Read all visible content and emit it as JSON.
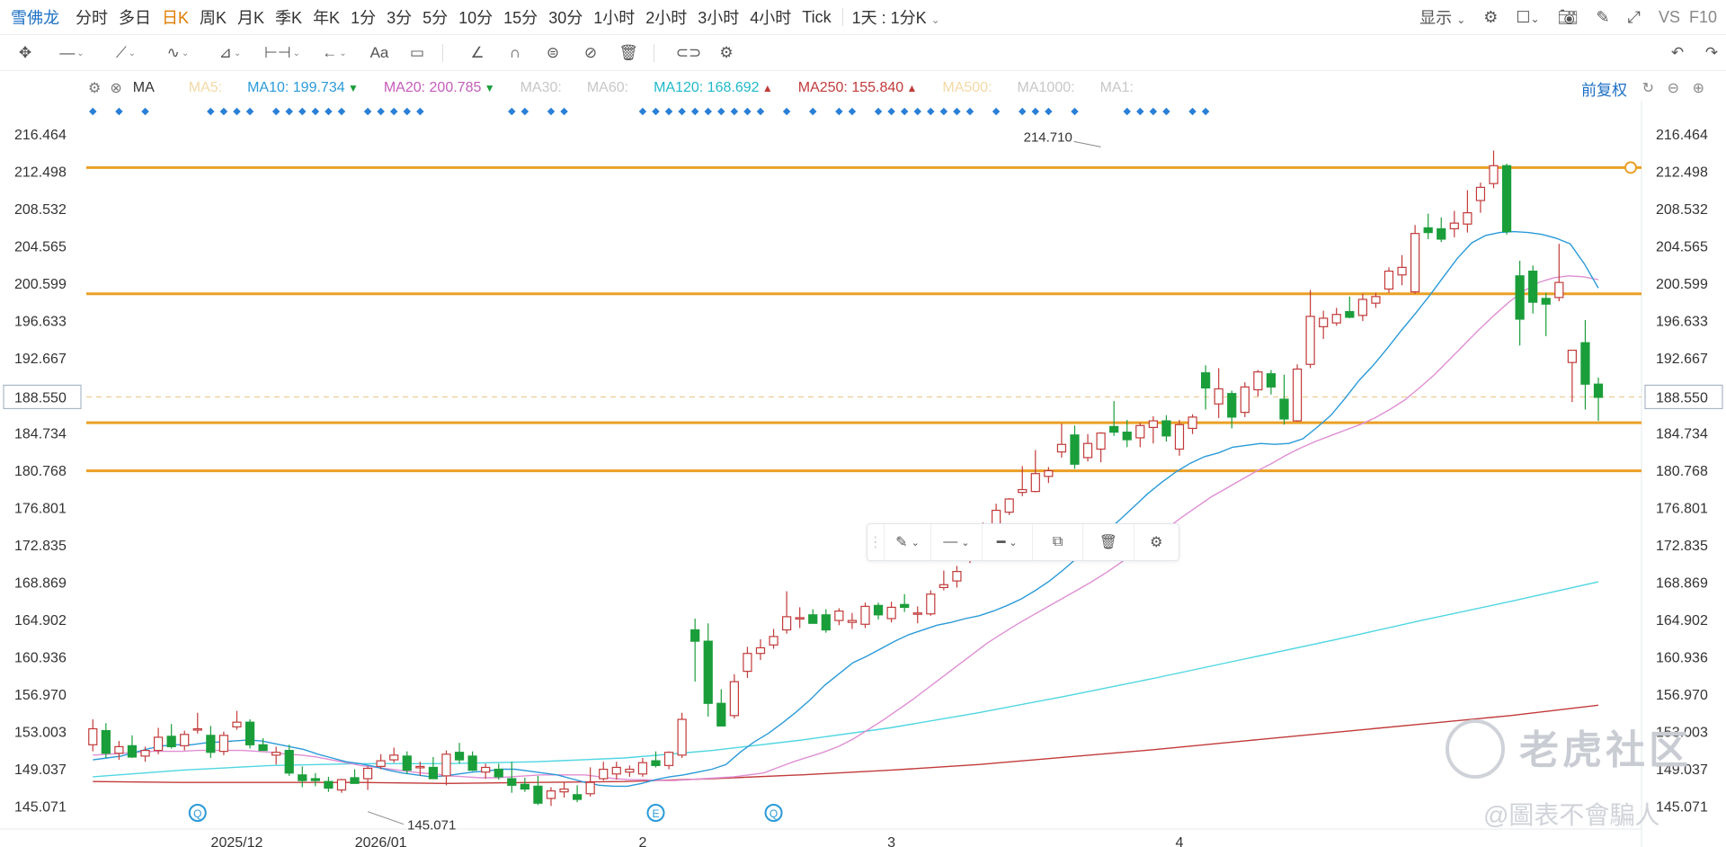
{
  "toolbar": {
    "symbol": "雪佛龙",
    "timeframes": [
      "分时",
      "多日",
      "日K",
      "周K",
      "月K",
      "季K",
      "年K",
      "1分",
      "3分",
      "5分",
      "10分",
      "15分",
      "30分",
      "1小时",
      "2小时",
      "3小时",
      "4小时",
      "Tick"
    ],
    "active_timeframe": "日K",
    "mode": "1天 : 1分K",
    "display": "显示",
    "compare": "VS",
    "f10": "F10"
  },
  "indicator": {
    "name": "MA",
    "adjust": "前复权",
    "items": [
      {
        "label": "MA5:",
        "value": "",
        "arrow": "",
        "color": "#f3d9a6"
      },
      {
        "label": "MA10:",
        "value": "199.734",
        "arrow": "▼",
        "color": "#2a9ad8"
      },
      {
        "label": "MA20:",
        "value": "200.785",
        "arrow": "▼",
        "color": "#c45cba"
      },
      {
        "label": "MA30:",
        "value": "",
        "arrow": "",
        "color": "#c7c7c7"
      },
      {
        "label": "MA60:",
        "value": "",
        "arrow": "",
        "color": "#c7c7c7"
      },
      {
        "label": "MA120:",
        "value": "168.692",
        "arrow": "▲",
        "color": "#1fb8c9"
      },
      {
        "label": "MA250:",
        "value": "155.840",
        "arrow": "▲",
        "color": "#c23a3a"
      },
      {
        "label": "MA500:",
        "value": "",
        "arrow": "",
        "color": "#f3d9a6"
      },
      {
        "label": "MA1000:",
        "value": "",
        "arrow": "",
        "color": "#c7c7c7"
      },
      {
        "label": "MA1:",
        "value": "",
        "arrow": "",
        "color": "#c7c7c7"
      }
    ]
  },
  "colors": {
    "up": "#c23a3a",
    "down": "#1a9e3a",
    "hline": "#eaa025",
    "ma10": "#2a9ad8",
    "ma20": "#df8fd3",
    "ma120": "#4fd6e2",
    "ma250": "#c23a3a"
  },
  "chart_data": {
    "type": "candlestick",
    "y_ticks": [
      "216.464",
      "212.498",
      "208.532",
      "204.565",
      "200.599",
      "196.633",
      "192.667",
      "188.550",
      "184.734",
      "180.768",
      "176.801",
      "172.835",
      "168.869",
      "164.902",
      "160.936",
      "156.970",
      "153.003",
      "149.037",
      "145.071"
    ],
    "ylim": [
      143.8,
      217.9
    ],
    "x_labels": [
      {
        "label": "2025/12",
        "index": 11
      },
      {
        "label": "2026/01",
        "index": 22
      },
      {
        "label": "2",
        "index": 42
      },
      {
        "label": "3",
        "index": 61
      },
      {
        "label": "4",
        "index": 83
      }
    ],
    "last_price": 188.55,
    "high_marker": {
      "value": 214.71,
      "label": "214.710",
      "index": 77
    },
    "low_marker": {
      "value": 145.071,
      "label": "145.071",
      "index": 21
    },
    "horizontal_lines": [
      212.9,
      199.5,
      185.8,
      180.7
    ],
    "markers": [
      {
        "index": 8,
        "symbol": "Q"
      },
      {
        "index": 43,
        "symbol": "E"
      },
      {
        "index": 52,
        "symbol": "Q"
      }
    ],
    "signal_dots": [
      0,
      2,
      4,
      9,
      10,
      11,
      12,
      14,
      15,
      16,
      17,
      18,
      19,
      21,
      22,
      23,
      24,
      25,
      32,
      33,
      35,
      36,
      42,
      43,
      44,
      45,
      46,
      47,
      48,
      49,
      50,
      51,
      53,
      55,
      57,
      58,
      60,
      61,
      62,
      63,
      64,
      65,
      66,
      67,
      69,
      71,
      72,
      73,
      75,
      79,
      80,
      81,
      82,
      84,
      85
    ],
    "candles": [
      {
        "o": 151.6,
        "h": 154.3,
        "l": 150.9,
        "c": 153.3
      },
      {
        "o": 153.1,
        "h": 153.9,
        "l": 150.2,
        "c": 150.7
      },
      {
        "o": 150.7,
        "h": 152.0,
        "l": 150.0,
        "c": 151.4
      },
      {
        "o": 151.5,
        "h": 152.6,
        "l": 150.2,
        "c": 150.3
      },
      {
        "o": 150.4,
        "h": 151.4,
        "l": 149.8,
        "c": 151.0
      },
      {
        "o": 151.0,
        "h": 153.4,
        "l": 150.6,
        "c": 152.4
      },
      {
        "o": 152.5,
        "h": 153.8,
        "l": 151.2,
        "c": 151.4
      },
      {
        "o": 151.5,
        "h": 153.1,
        "l": 151.0,
        "c": 152.7
      },
      {
        "o": 153.2,
        "h": 155.0,
        "l": 152.8,
        "c": 153.3
      },
      {
        "o": 152.6,
        "h": 153.6,
        "l": 150.2,
        "c": 150.8
      },
      {
        "o": 150.9,
        "h": 153.0,
        "l": 150.5,
        "c": 152.6
      },
      {
        "o": 153.5,
        "h": 155.2,
        "l": 153.2,
        "c": 154.0
      },
      {
        "o": 154.0,
        "h": 154.3,
        "l": 151.2,
        "c": 151.6
      },
      {
        "o": 151.6,
        "h": 152.3,
        "l": 151.0,
        "c": 151.0
      },
      {
        "o": 150.5,
        "h": 151.4,
        "l": 149.5,
        "c": 150.8
      },
      {
        "o": 151.0,
        "h": 151.6,
        "l": 148.3,
        "c": 148.6
      },
      {
        "o": 148.4,
        "h": 149.3,
        "l": 147.1,
        "c": 147.8
      },
      {
        "o": 148.0,
        "h": 148.6,
        "l": 147.2,
        "c": 147.8
      },
      {
        "o": 147.7,
        "h": 148.2,
        "l": 146.6,
        "c": 147.0
      },
      {
        "o": 146.8,
        "h": 148.0,
        "l": 146.5,
        "c": 147.9
      },
      {
        "o": 148.1,
        "h": 149.0,
        "l": 147.5,
        "c": 147.5
      },
      {
        "o": 148.0,
        "h": 149.3,
        "l": 146.8,
        "c": 149.1
      },
      {
        "o": 149.3,
        "h": 150.6,
        "l": 149.0,
        "c": 149.9
      },
      {
        "o": 150.0,
        "h": 151.3,
        "l": 149.7,
        "c": 150.5
      },
      {
        "o": 150.4,
        "h": 150.9,
        "l": 148.5,
        "c": 148.9
      },
      {
        "o": 149.2,
        "h": 149.8,
        "l": 148.3,
        "c": 149.3
      },
      {
        "o": 149.2,
        "h": 150.3,
        "l": 148.2,
        "c": 148.0
      },
      {
        "o": 148.3,
        "h": 151.0,
        "l": 147.3,
        "c": 150.6
      },
      {
        "o": 150.8,
        "h": 151.8,
        "l": 149.6,
        "c": 150.0
      },
      {
        "o": 150.4,
        "h": 150.9,
        "l": 148.8,
        "c": 148.9
      },
      {
        "o": 148.7,
        "h": 149.6,
        "l": 148.0,
        "c": 149.2
      },
      {
        "o": 149.0,
        "h": 149.6,
        "l": 147.9,
        "c": 148.2
      },
      {
        "o": 148.0,
        "h": 149.8,
        "l": 146.5,
        "c": 147.3
      },
      {
        "o": 147.4,
        "h": 148.1,
        "l": 146.6,
        "c": 146.9
      },
      {
        "o": 147.2,
        "h": 148.3,
        "l": 145.2,
        "c": 145.4
      },
      {
        "o": 145.9,
        "h": 147.1,
        "l": 145.1,
        "c": 146.7
      },
      {
        "o": 146.6,
        "h": 147.6,
        "l": 146.0,
        "c": 146.9
      },
      {
        "o": 146.3,
        "h": 147.3,
        "l": 145.5,
        "c": 145.8
      },
      {
        "o": 146.4,
        "h": 149.2,
        "l": 146.1,
        "c": 147.6
      },
      {
        "o": 148.0,
        "h": 149.8,
        "l": 147.8,
        "c": 149.0
      },
      {
        "o": 148.5,
        "h": 149.8,
        "l": 147.9,
        "c": 149.2
      },
      {
        "o": 148.7,
        "h": 149.4,
        "l": 148.2,
        "c": 149.0
      },
      {
        "o": 148.5,
        "h": 150.2,
        "l": 148.2,
        "c": 149.7
      },
      {
        "o": 149.9,
        "h": 150.9,
        "l": 149.2,
        "c": 149.4
      },
      {
        "o": 149.4,
        "h": 150.9,
        "l": 149.0,
        "c": 150.8
      },
      {
        "o": 150.5,
        "h": 155.0,
        "l": 150.2,
        "c": 154.3
      },
      {
        "o": 163.8,
        "h": 165.0,
        "l": 158.3,
        "c": 162.6
      },
      {
        "o": 162.6,
        "h": 164.5,
        "l": 154.6,
        "c": 156.0
      },
      {
        "o": 156.0,
        "h": 157.5,
        "l": 153.6,
        "c": 153.6
      },
      {
        "o": 154.7,
        "h": 159.1,
        "l": 154.4,
        "c": 158.3
      },
      {
        "o": 159.4,
        "h": 162.0,
        "l": 158.7,
        "c": 161.3
      },
      {
        "o": 161.3,
        "h": 162.8,
        "l": 160.6,
        "c": 161.9
      },
      {
        "o": 162.2,
        "h": 163.9,
        "l": 161.8,
        "c": 163.1
      },
      {
        "o": 163.8,
        "h": 167.9,
        "l": 163.4,
        "c": 165.2
      },
      {
        "o": 165.1,
        "h": 166.2,
        "l": 164.0,
        "c": 165.1
      },
      {
        "o": 165.4,
        "h": 166.0,
        "l": 164.6,
        "c": 164.5
      },
      {
        "o": 165.4,
        "h": 166.0,
        "l": 163.5,
        "c": 163.8
      },
      {
        "o": 164.8,
        "h": 166.1,
        "l": 164.3,
        "c": 165.8
      },
      {
        "o": 164.6,
        "h": 165.6,
        "l": 163.9,
        "c": 164.8
      },
      {
        "o": 164.4,
        "h": 166.7,
        "l": 164.0,
        "c": 166.3
      },
      {
        "o": 166.4,
        "h": 166.7,
        "l": 164.9,
        "c": 165.4
      },
      {
        "o": 165.0,
        "h": 166.8,
        "l": 164.6,
        "c": 166.2
      },
      {
        "o": 166.5,
        "h": 167.6,
        "l": 165.7,
        "c": 166.2
      },
      {
        "o": 165.6,
        "h": 166.3,
        "l": 164.5,
        "c": 165.6
      },
      {
        "o": 165.5,
        "h": 168.0,
        "l": 165.3,
        "c": 167.6
      },
      {
        "o": 168.3,
        "h": 170.1,
        "l": 168.0,
        "c": 168.6
      },
      {
        "o": 169.0,
        "h": 170.6,
        "l": 168.3,
        "c": 170.0
      },
      {
        "o": 171.5,
        "h": 174.4,
        "l": 170.9,
        "c": 174.0
      },
      {
        "o": 173.4,
        "h": 175.2,
        "l": 172.5,
        "c": 174.8
      },
      {
        "o": 174.8,
        "h": 177.2,
        "l": 174.4,
        "c": 176.5
      },
      {
        "o": 176.3,
        "h": 177.8,
        "l": 176.0,
        "c": 177.7
      },
      {
        "o": 178.4,
        "h": 181.2,
        "l": 178.0,
        "c": 178.7
      },
      {
        "o": 178.5,
        "h": 182.9,
        "l": 178.4,
        "c": 180.4
      },
      {
        "o": 180.1,
        "h": 181.1,
        "l": 179.4,
        "c": 180.7
      }
    ],
    "series": [
      {
        "name": "MA10",
        "values": [
          150.0,
          150.2,
          150.4,
          150.8,
          151.2,
          151.5,
          151.6,
          151.6,
          151.8,
          151.9,
          152.0,
          152.1,
          152.0,
          151.7,
          151.4,
          151.1,
          150.6,
          150.2,
          149.8,
          149.6,
          149.3,
          148.9,
          148.6,
          148.4,
          148.2,
          148.3,
          148.5,
          148.7,
          148.8,
          149.0,
          149.0,
          148.8,
          148.6,
          148.4,
          148.0,
          147.6,
          147.3,
          147.2,
          147.2,
          147.5,
          147.9,
          148.2,
          148.4,
          148.7,
          149.0,
          149.5,
          150.8,
          151.9,
          152.8,
          153.9,
          155.1,
          156.4,
          157.9,
          159.1,
          160.3,
          161.0,
          161.8,
          162.6,
          163.3,
          163.8,
          164.3,
          164.6,
          165.0,
          165.3,
          165.8,
          166.4,
          167.1,
          168.0,
          169.0,
          170.2,
          171.5,
          172.9,
          174.2,
          175.5,
          176.9,
          178.3,
          179.5,
          180.6,
          181.5,
          182.2,
          182.6,
          183.2,
          183.4,
          183.6,
          183.5,
          183.6,
          184.1,
          185.3,
          186.6,
          188.4,
          190.3,
          191.9,
          193.7,
          195.6,
          197.4,
          199.3,
          201.3,
          203.3,
          204.9,
          205.7,
          206.0,
          206.1,
          206.0,
          205.8,
          205.4,
          204.8,
          202.7,
          200.1
        ]
      },
      {
        "name": "MA20",
        "values": [
          150.5,
          150.6,
          150.7,
          150.8,
          150.9,
          150.9,
          150.9,
          151.0,
          151.0,
          151.0,
          151.0,
          150.9,
          150.8,
          150.6,
          150.5,
          150.3,
          150.0,
          149.7,
          149.4,
          149.2,
          149.0,
          148.8,
          148.6,
          148.5,
          148.3,
          148.2,
          148.1,
          148.1,
          148.2,
          148.3,
          148.4,
          148.4,
          148.4,
          148.4,
          148.2,
          148.0,
          147.9,
          147.9,
          147.8,
          147.8,
          147.9,
          148.0,
          148.1,
          148.2,
          148.4,
          148.6,
          149.2,
          149.8,
          150.3,
          150.8,
          151.4,
          152.2,
          153.2,
          154.2,
          155.3,
          156.4,
          157.6,
          158.8,
          160.0,
          161.2,
          162.4,
          163.4,
          164.4,
          165.3,
          166.2,
          167.1,
          168.0,
          168.9,
          169.9,
          171.0,
          172.1,
          173.3,
          174.5,
          175.7,
          176.8,
          177.9,
          178.8,
          179.7,
          180.6,
          181.4,
          182.3,
          183.1,
          183.8,
          184.4,
          185.0,
          185.6,
          186.3,
          187.2,
          188.2,
          189.5,
          190.9,
          192.5,
          194.1,
          195.7,
          197.2,
          198.6,
          199.8,
          200.7,
          201.2,
          201.4,
          201.3,
          201.0
        ]
      },
      {
        "name": "MA120",
        "values": [
          148.2,
          148.9,
          149.4,
          149.6,
          149.6,
          149.8,
          150.2,
          151.0,
          152.1,
          153.4,
          155.0,
          156.8,
          158.7,
          160.7,
          162.7,
          164.8,
          166.8,
          168.9
        ]
      },
      {
        "name": "MA250",
        "values": [
          147.7,
          147.6,
          147.6,
          147.6,
          147.5,
          147.6,
          147.7,
          148.0,
          148.4,
          148.9,
          149.5,
          150.3,
          151.1,
          152.0,
          152.9,
          153.8,
          154.7,
          155.8
        ]
      }
    ],
    "candles_extra": [
      {
        "o": 182.7,
        "h": 185.7,
        "l": 182.1,
        "c": 183.5
      },
      {
        "o": 184.5,
        "h": 185.5,
        "l": 180.9,
        "c": 181.4
      },
      {
        "o": 182.1,
        "h": 184.6,
        "l": 181.7,
        "c": 183.6
      },
      {
        "o": 183.0,
        "h": 184.8,
        "l": 181.6,
        "c": 184.7
      },
      {
        "o": 185.4,
        "h": 188.1,
        "l": 184.4,
        "c": 184.8
      },
      {
        "o": 184.8,
        "h": 186.1,
        "l": 183.2,
        "c": 184.0
      },
      {
        "o": 184.2,
        "h": 185.8,
        "l": 183.2,
        "c": 185.5
      },
      {
        "o": 185.3,
        "h": 186.5,
        "l": 183.6,
        "c": 186.0
      },
      {
        "o": 186.0,
        "h": 186.6,
        "l": 183.8,
        "c": 184.4
      },
      {
        "o": 183.0,
        "h": 186.1,
        "l": 182.3,
        "c": 185.6
      },
      {
        "o": 185.2,
        "h": 186.7,
        "l": 184.6,
        "c": 186.4
      },
      {
        "o": 191.1,
        "h": 191.9,
        "l": 187.2,
        "c": 189.5
      },
      {
        "o": 187.8,
        "h": 191.6,
        "l": 186.3,
        "c": 189.4
      },
      {
        "o": 188.9,
        "h": 189.2,
        "l": 185.2,
        "c": 186.4
      },
      {
        "o": 186.9,
        "h": 190.1,
        "l": 186.4,
        "c": 189.6
      },
      {
        "o": 189.3,
        "h": 191.4,
        "l": 188.6,
        "c": 191.2
      },
      {
        "o": 191.0,
        "h": 191.4,
        "l": 188.8,
        "c": 189.6
      },
      {
        "o": 188.3,
        "h": 190.9,
        "l": 185.6,
        "c": 186.2
      },
      {
        "o": 186.0,
        "h": 192.0,
        "l": 185.9,
        "c": 191.5
      },
      {
        "o": 192.0,
        "h": 199.9,
        "l": 191.6,
        "c": 197.1
      },
      {
        "o": 196.0,
        "h": 197.7,
        "l": 194.7,
        "c": 196.9
      },
      {
        "o": 196.4,
        "h": 198.0,
        "l": 196.1,
        "c": 197.3
      },
      {
        "o": 197.6,
        "h": 199.2,
        "l": 196.9,
        "c": 197.0
      },
      {
        "o": 197.2,
        "h": 199.5,
        "l": 196.6,
        "c": 198.9
      },
      {
        "o": 198.5,
        "h": 199.6,
        "l": 198.0,
        "c": 199.2
      },
      {
        "o": 200.0,
        "h": 202.3,
        "l": 199.6,
        "c": 201.9
      },
      {
        "o": 201.5,
        "h": 203.6,
        "l": 200.4,
        "c": 202.3
      },
      {
        "o": 199.7,
        "h": 206.8,
        "l": 199.5,
        "c": 205.9
      },
      {
        "o": 206.5,
        "h": 208.0,
        "l": 205.3,
        "c": 206.0
      },
      {
        "o": 206.4,
        "h": 207.6,
        "l": 205.0,
        "c": 205.3
      },
      {
        "o": 206.4,
        "h": 208.3,
        "l": 205.5,
        "c": 207.0
      },
      {
        "o": 206.9,
        "h": 210.5,
        "l": 206.0,
        "c": 208.1
      },
      {
        "o": 209.4,
        "h": 211.3,
        "l": 208.1,
        "c": 210.8
      },
      {
        "o": 211.2,
        "h": 214.7,
        "l": 210.7,
        "c": 213.1
      },
      {
        "o": 213.1,
        "h": 213.3,
        "l": 205.8,
        "c": 206.1
      },
      {
        "o": 201.4,
        "h": 203.0,
        "l": 194.0,
        "c": 196.8
      },
      {
        "o": 201.9,
        "h": 202.5,
        "l": 197.4,
        "c": 198.6
      },
      {
        "o": 199.0,
        "h": 199.6,
        "l": 195.0,
        "c": 198.4
      },
      {
        "o": 199.1,
        "h": 204.8,
        "l": 198.7,
        "c": 200.7
      },
      {
        "o": 192.2,
        "h": 192.9,
        "l": 188.0,
        "c": 193.5
      },
      {
        "o": 194.3,
        "h": 196.7,
        "l": 187.2,
        "c": 189.9
      },
      {
        "o": 189.9,
        "h": 190.6,
        "l": 186.0,
        "c": 188.5
      }
    ]
  },
  "float_toolbar": {
    "icons": [
      "pen-icon",
      "line-style-icon",
      "line-width-icon",
      "copy-icon",
      "trash-icon",
      "settings-icon"
    ]
  },
  "watermark": {
    "brand": "老虎社区",
    "author": "@圖表不會騙人"
  }
}
